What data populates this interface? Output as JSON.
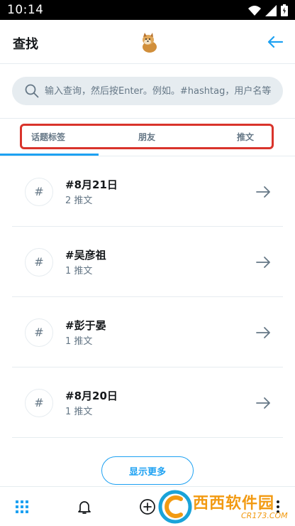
{
  "status_bar": {
    "time": "10:14"
  },
  "header": {
    "title": "查找"
  },
  "search": {
    "placeholder": "输入查询，然后按Enter。例如。#hashtag，用户名等"
  },
  "tabs": [
    {
      "label": "话题标签"
    },
    {
      "label": "朋友"
    },
    {
      "label": "推文"
    }
  ],
  "hashtags": [
    {
      "symbol": "#",
      "title": "#8月21日",
      "count": "2 推文"
    },
    {
      "symbol": "#",
      "title": "#吴彦祖",
      "count": "1 推文"
    },
    {
      "symbol": "#",
      "title": "#彭于晏",
      "count": "1 推文"
    },
    {
      "symbol": "#",
      "title": "#8月20日",
      "count": "1 推文"
    }
  ],
  "show_more": {
    "label": "显示更多"
  },
  "bottom_nav": [
    "grid-icon",
    "bell-icon",
    "add-circle-icon",
    "overflow-icon"
  ],
  "watermark": {
    "title": "西西软件园",
    "domain": "CR173.COM"
  },
  "colors": {
    "accent": "#1da1f2",
    "highlight_border": "#d9342b",
    "muted": "#657786",
    "divider": "#e6ecf0"
  }
}
